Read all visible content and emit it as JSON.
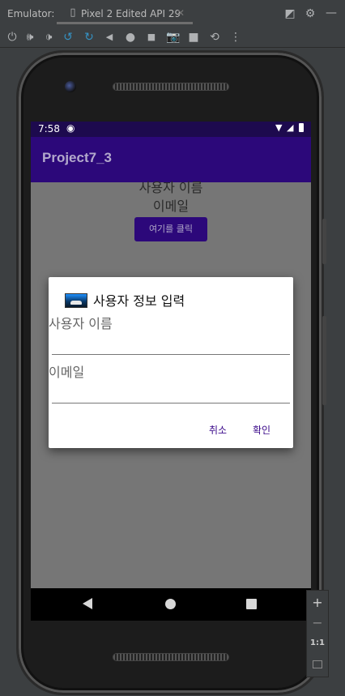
{
  "emulator": {
    "label": "Emulator:",
    "tab_title": "Pixel 2 Edited API 29",
    "tab_close": "✕"
  },
  "toolbar_top_icons": [
    "restore-window-icon",
    "gear-icon",
    "minimize-icon"
  ],
  "toolbar_controls": [
    "power-icon",
    "volume-up-icon",
    "volume-down-icon",
    "rotate-left-icon",
    "rotate-right-icon",
    "back-icon",
    "home-icon",
    "overview-icon",
    "screenshot-icon",
    "screen-record-icon",
    "snapshot-icon",
    "more-icon"
  ],
  "status_bar": {
    "time": "7:58"
  },
  "app": {
    "title": "Project7_3",
    "name_text": "사용자 이름",
    "email_text": "이메일",
    "button_label": "여기를 클릭"
  },
  "dialog": {
    "title": "사용자 정보 입력",
    "name_label": "사용자 이름",
    "name_value": "",
    "email_label": "이메일",
    "email_value": "",
    "cancel_label": "취소",
    "ok_label": "확인"
  },
  "zoom": {
    "zoom_in": "+",
    "zoom_out": "−",
    "one_to_one": "1:1"
  },
  "colors": {
    "status_bar": "#1d0a4e",
    "app_bar": "#2c087a",
    "accent": "#3b0a8a",
    "scrim": "#767676"
  }
}
